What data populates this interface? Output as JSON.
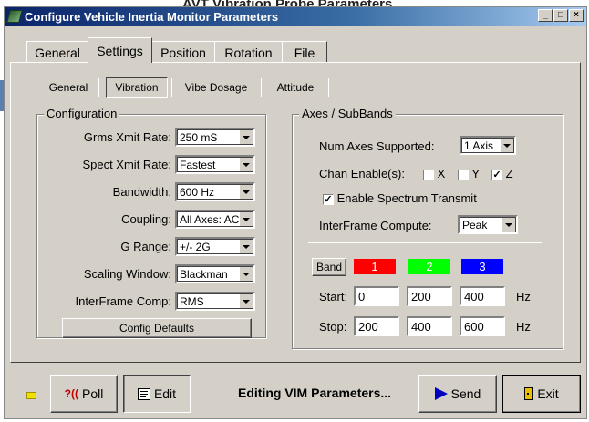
{
  "background_caption": "AVT Vibration Probe Parameters",
  "window": {
    "title": "Configure Vehicle Inertia Monitor Parameters",
    "buttons": {
      "minimize": "_",
      "maximize": "□",
      "close": "×"
    }
  },
  "tabs": [
    "General",
    "Settings",
    "Position",
    "Rotation",
    "File"
  ],
  "subtabs": [
    "General",
    "Vibration",
    "Vibe Dosage",
    "Attitude"
  ],
  "configuration": {
    "title": "Configuration",
    "rows": [
      {
        "label": "Grms Xmit Rate:",
        "value": "250 mS"
      },
      {
        "label": "Spect Xmit Rate:",
        "value": "Fastest"
      },
      {
        "label": "Bandwidth:",
        "value": "600 Hz"
      },
      {
        "label": "Coupling:",
        "value": "All Axes: AC"
      },
      {
        "label": "G Range:",
        "value": "+/- 2G"
      },
      {
        "label": "Scaling Window:",
        "value": "Blackman"
      },
      {
        "label": "InterFrame Comp:",
        "value": "RMS"
      }
    ],
    "defaults_button": "Config Defaults"
  },
  "axes": {
    "title": "Axes / SubBands",
    "num_axes_label": "Num Axes Supported:",
    "num_axes_value": "1 Axis",
    "chan_enable_label": "Chan Enable(s):",
    "channels": [
      {
        "label": "X",
        "checked": false,
        "mark": ""
      },
      {
        "label": "Y",
        "checked": false,
        "mark": ""
      },
      {
        "label": "Z",
        "checked": true,
        "mark": "✓"
      }
    ],
    "spectrum_label": "Enable Spectrum Transmit",
    "spectrum_mark": "✓",
    "interframe_label": "InterFrame Compute:",
    "interframe_value": "Peak",
    "band_button": "Band",
    "bands": [
      {
        "label": "1",
        "color": "#ff0000"
      },
      {
        "label": "2",
        "color": "#00ff00"
      },
      {
        "label": "3",
        "color": "#0000ff"
      }
    ],
    "start_label": "Start:",
    "start_values": [
      "0",
      "200",
      "400"
    ],
    "stop_label": "Stop:",
    "stop_values": [
      "200",
      "400",
      "600"
    ],
    "unit": "Hz"
  },
  "footer": {
    "poll_icon": "?((",
    "poll_label": "Poll",
    "edit_label": "Edit",
    "status": "Editing VIM Parameters...",
    "send_label": "Send",
    "exit_label": "Exit"
  }
}
